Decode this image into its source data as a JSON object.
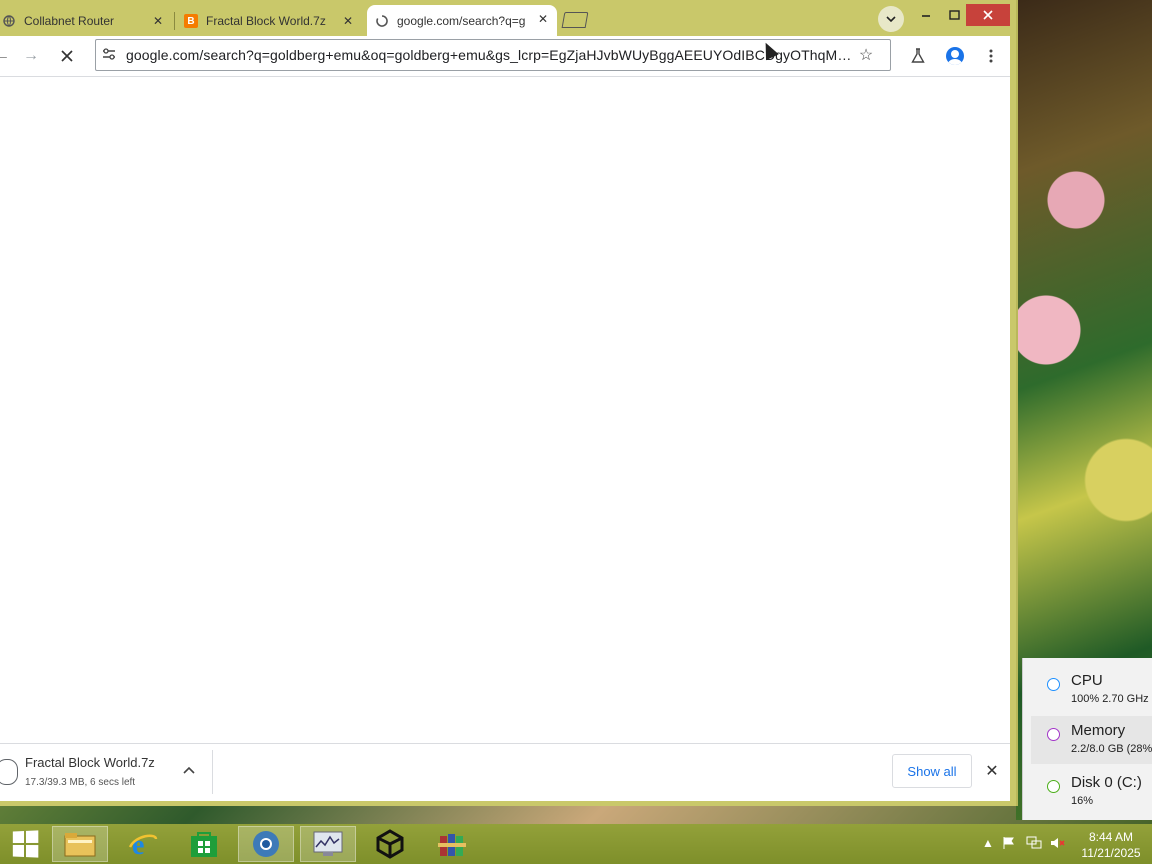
{
  "tabs": [
    {
      "title": "Collabnet Router",
      "favicon": "globe-icon"
    },
    {
      "title": "Fractal Block World.7z",
      "favicon": "blogger-icon",
      "favicon_text": "B",
      "favicon_color": "#f57c00"
    },
    {
      "title": "google.com/search?q=g",
      "favicon": "loading-icon",
      "active": true
    }
  ],
  "toolbar": {
    "url": "google.com/search?q=goldberg+emu&oq=goldberg+emu&gs_lcrp=EgZjaHJvbWUyBggAEEUYOdIBCDgyOThqMG..."
  },
  "download": {
    "filename": "Fractal Block World.7z",
    "status": "17.3/39.3 MB, 6 secs left",
    "show_all_label": "Show all"
  },
  "perf": {
    "items": [
      {
        "title": "CPU",
        "subtitle": "100% 2.70 GHz",
        "color": "#1e90ff"
      },
      {
        "title": "Memory",
        "subtitle": "2.2/8.0 GB (28%)",
        "color": "#a335c9",
        "selected": true
      },
      {
        "title": "Disk 0 (C:)",
        "subtitle": "16%",
        "color": "#4caf1a"
      }
    ]
  },
  "taskbar": {
    "time": "8:44 AM",
    "date": "11/21/2025"
  },
  "colors": {
    "frame": "#c9c86a",
    "close_button": "#c7423b",
    "accent": "#1a73e8"
  }
}
